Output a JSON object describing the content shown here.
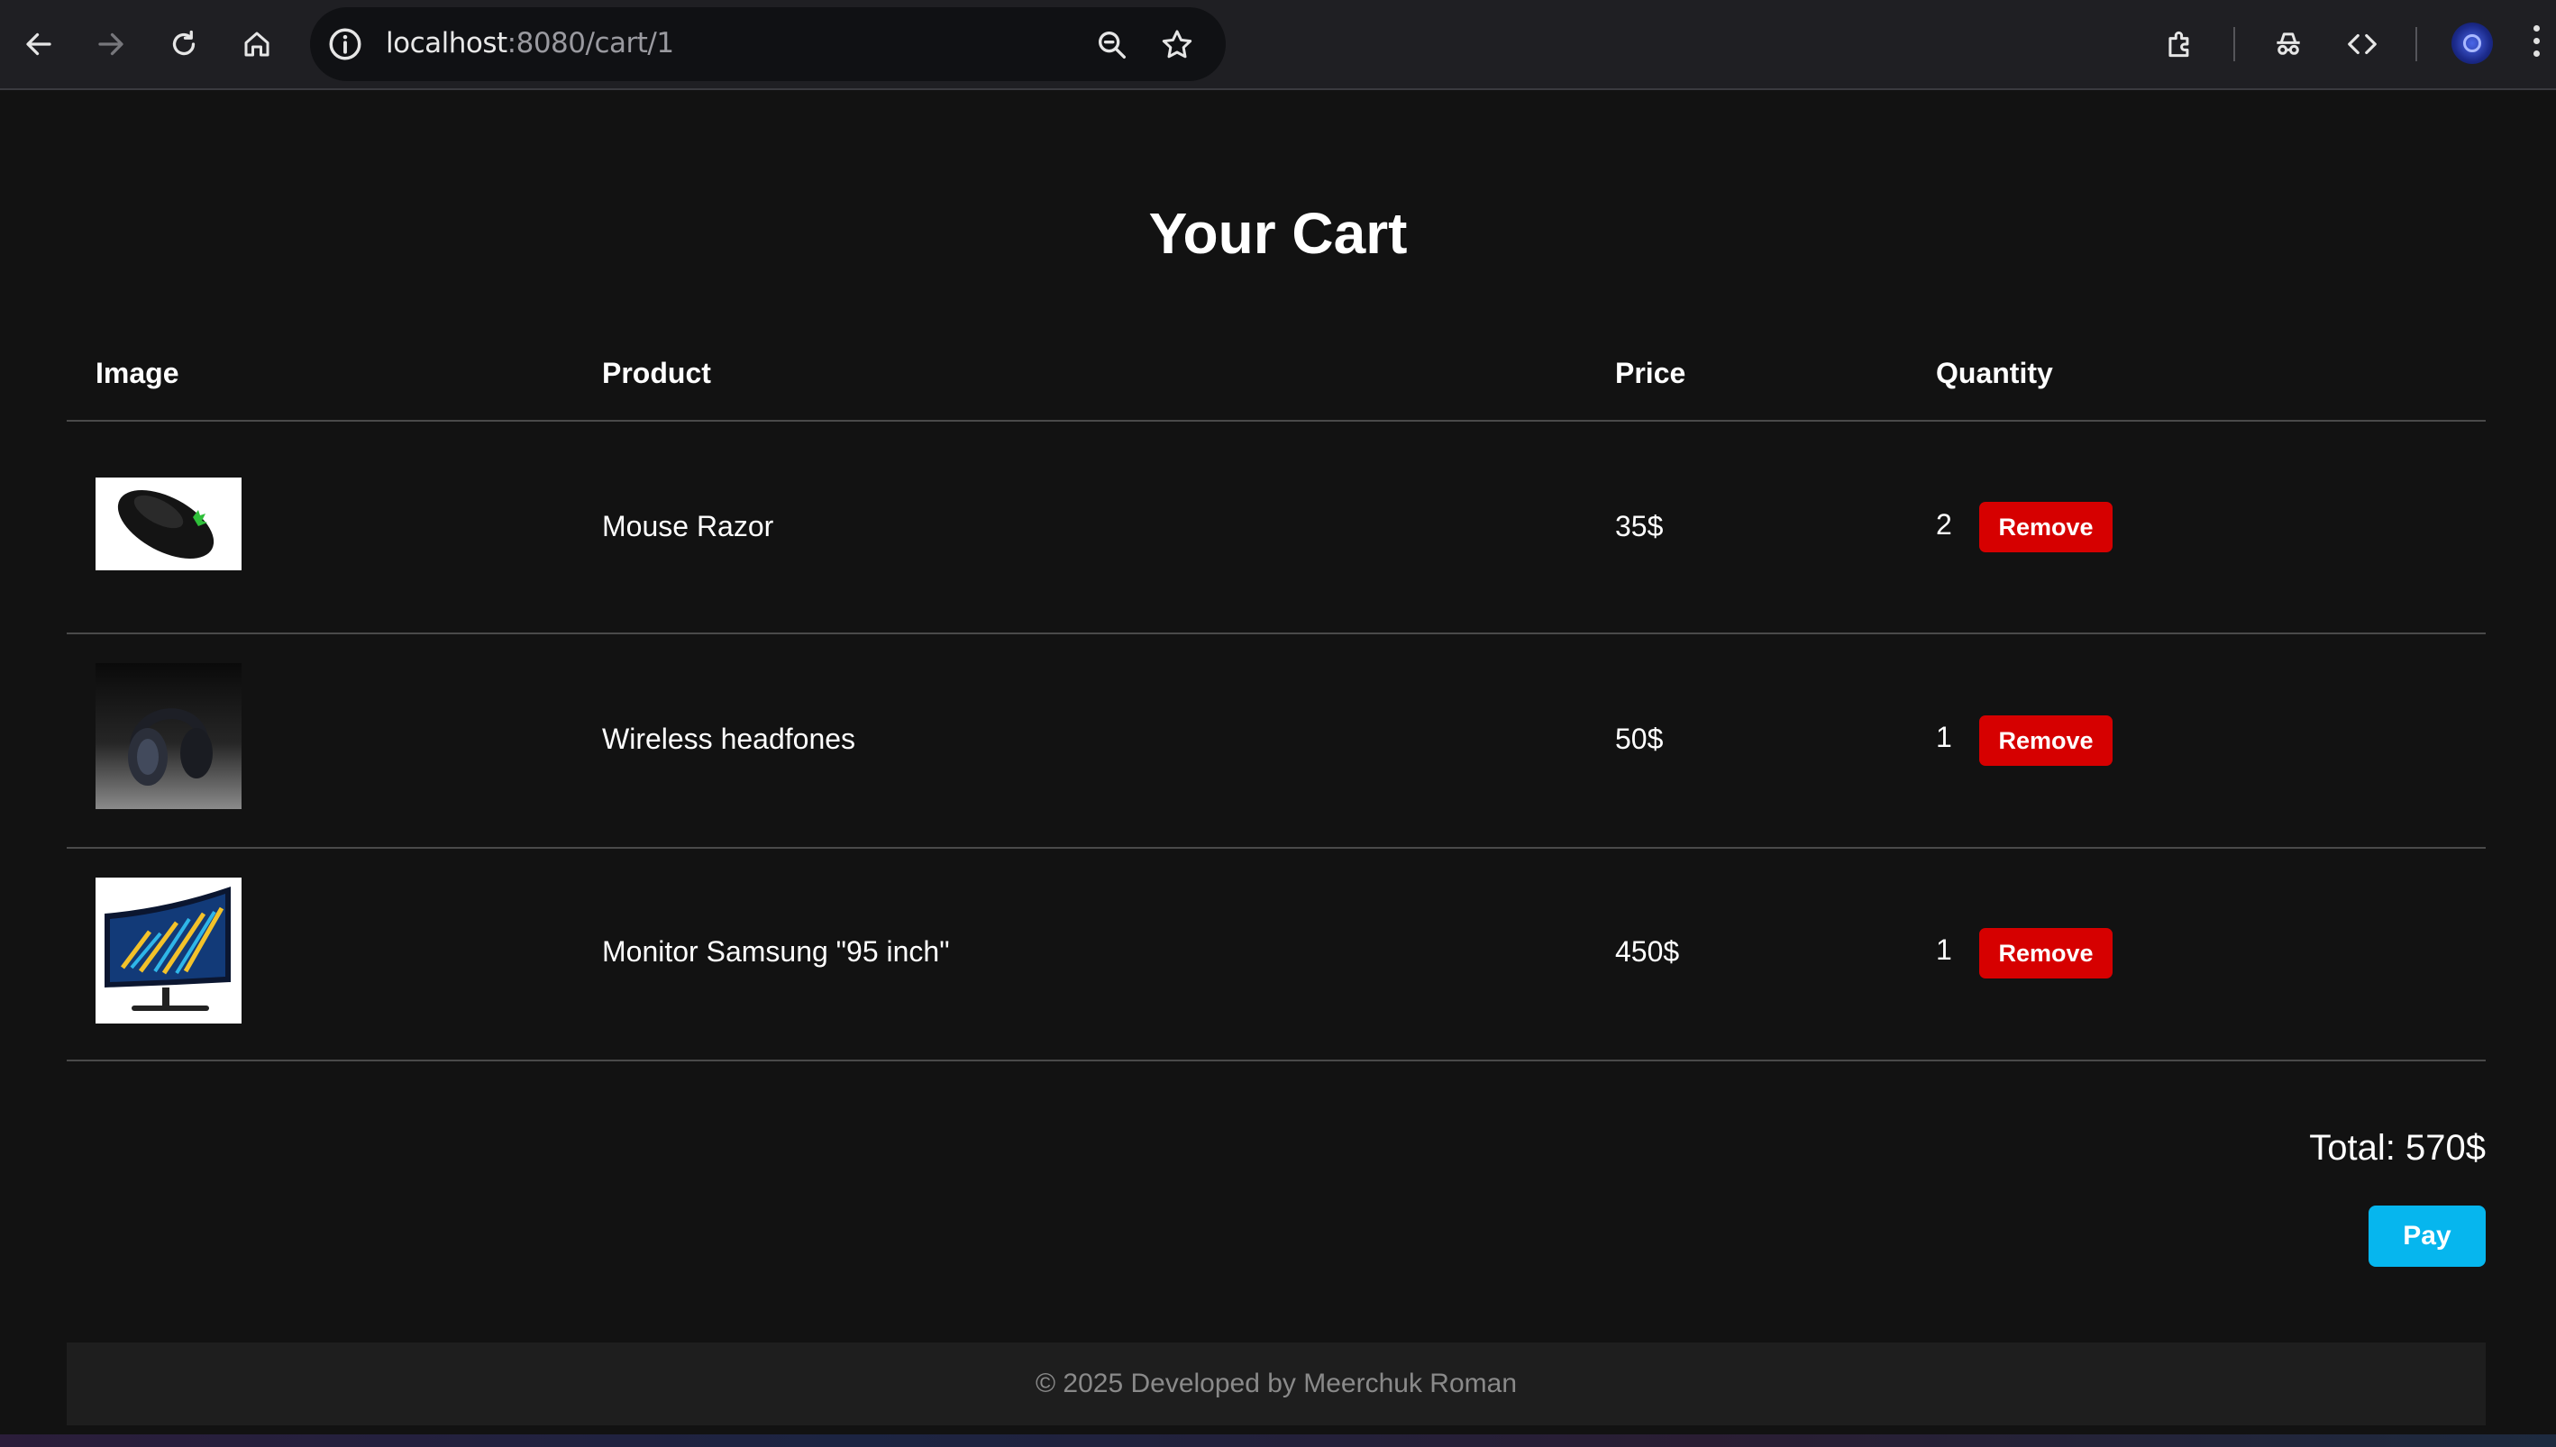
{
  "browser": {
    "url_host": "localhost",
    "url_rest": ":8080/cart/1"
  },
  "page": {
    "title": "Your Cart",
    "columns": [
      "Image",
      "Product",
      "Price",
      "Quantity"
    ],
    "items": [
      {
        "name": "Mouse Razor",
        "price": "35$",
        "quantity": "2",
        "image": "black-gaming-mouse",
        "remove_label": "Remove"
      },
      {
        "name": "Wireless headfones",
        "price": "50$",
        "quantity": "1",
        "image": "black-headphones",
        "remove_label": "Remove"
      },
      {
        "name": "Monitor Samsung \"95 inch\"",
        "price": "450$",
        "quantity": "1",
        "image": "curved-monitor",
        "remove_label": "Remove"
      }
    ],
    "total": "Total: 570$",
    "pay_label": "Pay",
    "footer": "© 2025 Developed by Meerchuk Roman"
  },
  "colors": {
    "background": "#121212",
    "remove_button": "#d60000",
    "pay_button": "#06b6ee",
    "footer_bg": "#1e1e1e"
  }
}
